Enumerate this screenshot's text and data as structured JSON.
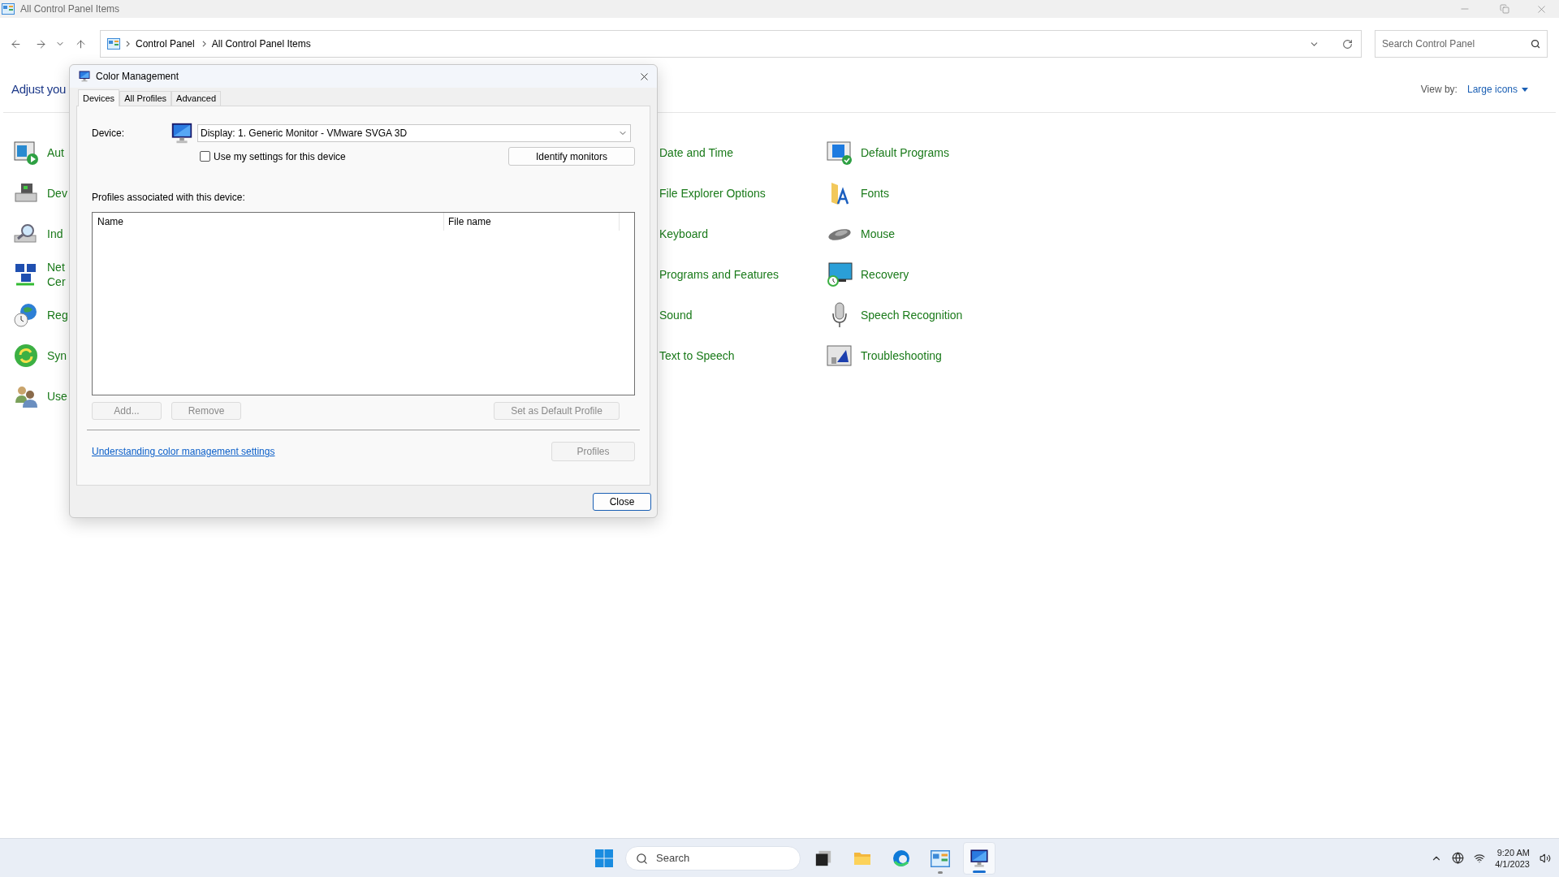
{
  "window": {
    "title": "All Control Panel Items"
  },
  "address_bar": {
    "breadcrumbs": [
      "Control Panel",
      "All Control Panel Items"
    ],
    "search": {
      "placeholder": "Search Control Panel"
    }
  },
  "header": {
    "title": "Adjust you",
    "view_by_label": "View by:",
    "view_by_value": "Large icons"
  },
  "columns": [
    {
      "items": [
        {
          "lines": [
            "Aut"
          ]
        },
        {
          "lines": [
            "Dev"
          ]
        },
        {
          "lines": [
            "Ind"
          ]
        },
        {
          "lines": [
            "Net",
            "Cer"
          ]
        },
        {
          "lines": [
            "Reg"
          ]
        },
        {
          "lines": [
            "Syn"
          ]
        },
        {
          "lines": [
            "Use"
          ]
        }
      ]
    },
    {
      "items": [
        {
          "lines": [
            "Date and Time"
          ]
        },
        {
          "lines": [
            "File Explorer Options"
          ]
        },
        {
          "lines": [
            "Keyboard"
          ]
        },
        {
          "lines": [
            "Programs and Features"
          ]
        },
        {
          "lines": [
            "Sound"
          ]
        },
        {
          "lines": [
            "Text to Speech"
          ]
        }
      ]
    },
    {
      "items": [
        {
          "lines": [
            "Default Programs"
          ]
        },
        {
          "lines": [
            "Fonts"
          ]
        },
        {
          "lines": [
            "Mouse"
          ]
        },
        {
          "lines": [
            "Recovery"
          ]
        },
        {
          "lines": [
            "Speech Recognition"
          ]
        },
        {
          "lines": [
            "Troubleshooting"
          ]
        }
      ]
    }
  ],
  "dialog": {
    "title": "Color Management",
    "tabs": [
      {
        "label": "Devices",
        "selected": true
      },
      {
        "label": "All Profiles",
        "selected": false
      },
      {
        "label": "Advanced",
        "selected": false
      }
    ],
    "device_label": "Device:",
    "device_value": "Display: 1. Generic Monitor - VMware SVGA 3D",
    "checkbox": {
      "label": "Use my settings for this device",
      "checked": false
    },
    "identify_button": "Identify monitors",
    "profiles_label": "Profiles associated with this device:",
    "table": {
      "columns": [
        "Name",
        "File name"
      ]
    },
    "buttons": [
      {
        "label": "Add...",
        "disabled": true
      },
      {
        "label": "Remove",
        "disabled": true
      },
      {
        "label": "Set as Default Profile",
        "disabled": true
      }
    ],
    "link": "Understanding color management settings",
    "profiles_button": {
      "label": "Profiles",
      "disabled": true
    },
    "close_button": "Close"
  },
  "taskbar": {
    "search": {
      "placeholder": "Search"
    },
    "apps": [
      {
        "running": false,
        "focused": false
      },
      {
        "running": false,
        "focused": false
      },
      {
        "running": false,
        "focused": false
      },
      {
        "running": true,
        "focused": false
      },
      {
        "running": true,
        "focused": true
      }
    ],
    "time": "9:20 AM",
    "date": "4/1/2023"
  }
}
